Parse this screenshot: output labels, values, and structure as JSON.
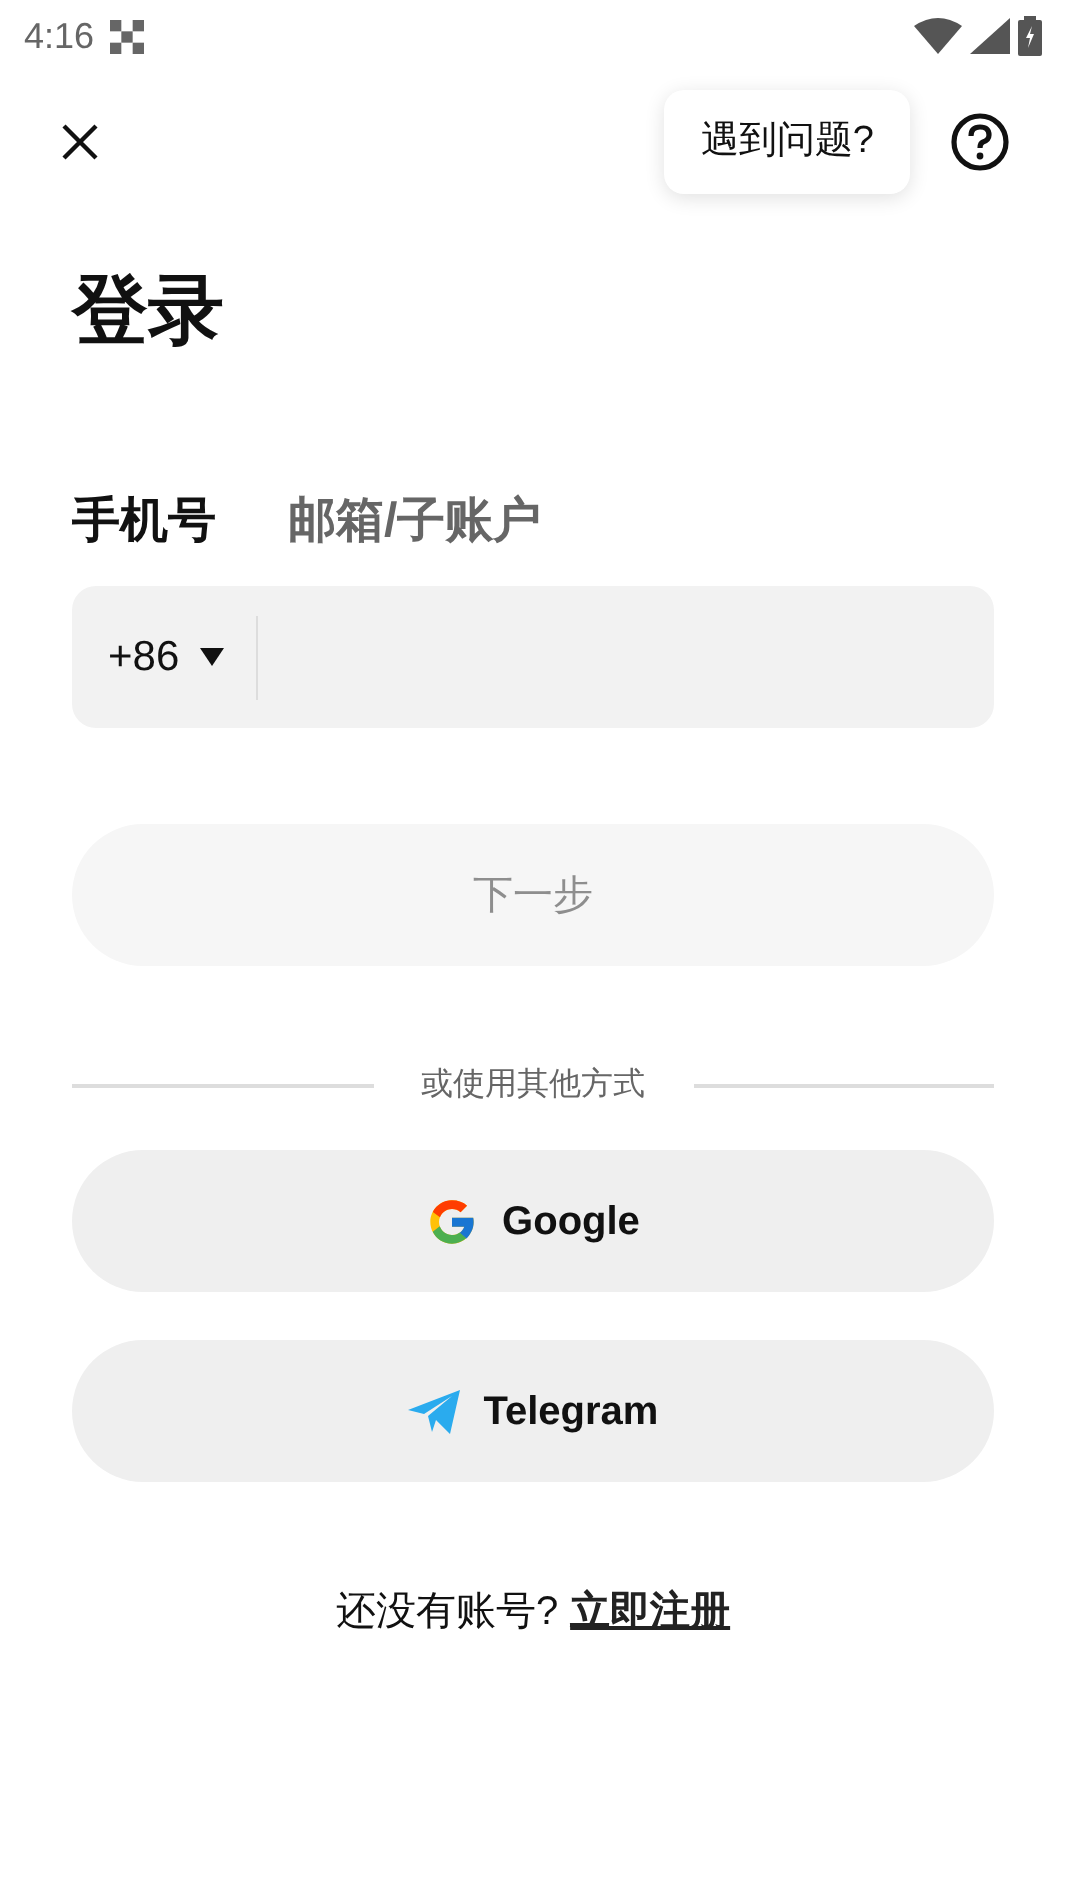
{
  "status_bar": {
    "time": "4:16"
  },
  "help_tooltip": "遇到问题?",
  "title": "登录",
  "tabs": [
    {
      "label": "手机号",
      "selected": true
    },
    {
      "label": "邮箱/子账户",
      "selected": false
    }
  ],
  "phone_field": {
    "country_code": "+86"
  },
  "next_button": {
    "label": "下一步",
    "disabled": true
  },
  "divider_text": "或使用其他方式",
  "social_buttons": [
    {
      "kind": "google",
      "label": "Google"
    },
    {
      "kind": "telegram",
      "label": "Telegram"
    }
  ],
  "register": {
    "prompt": "还没有账号?",
    "link": "立即注册"
  }
}
